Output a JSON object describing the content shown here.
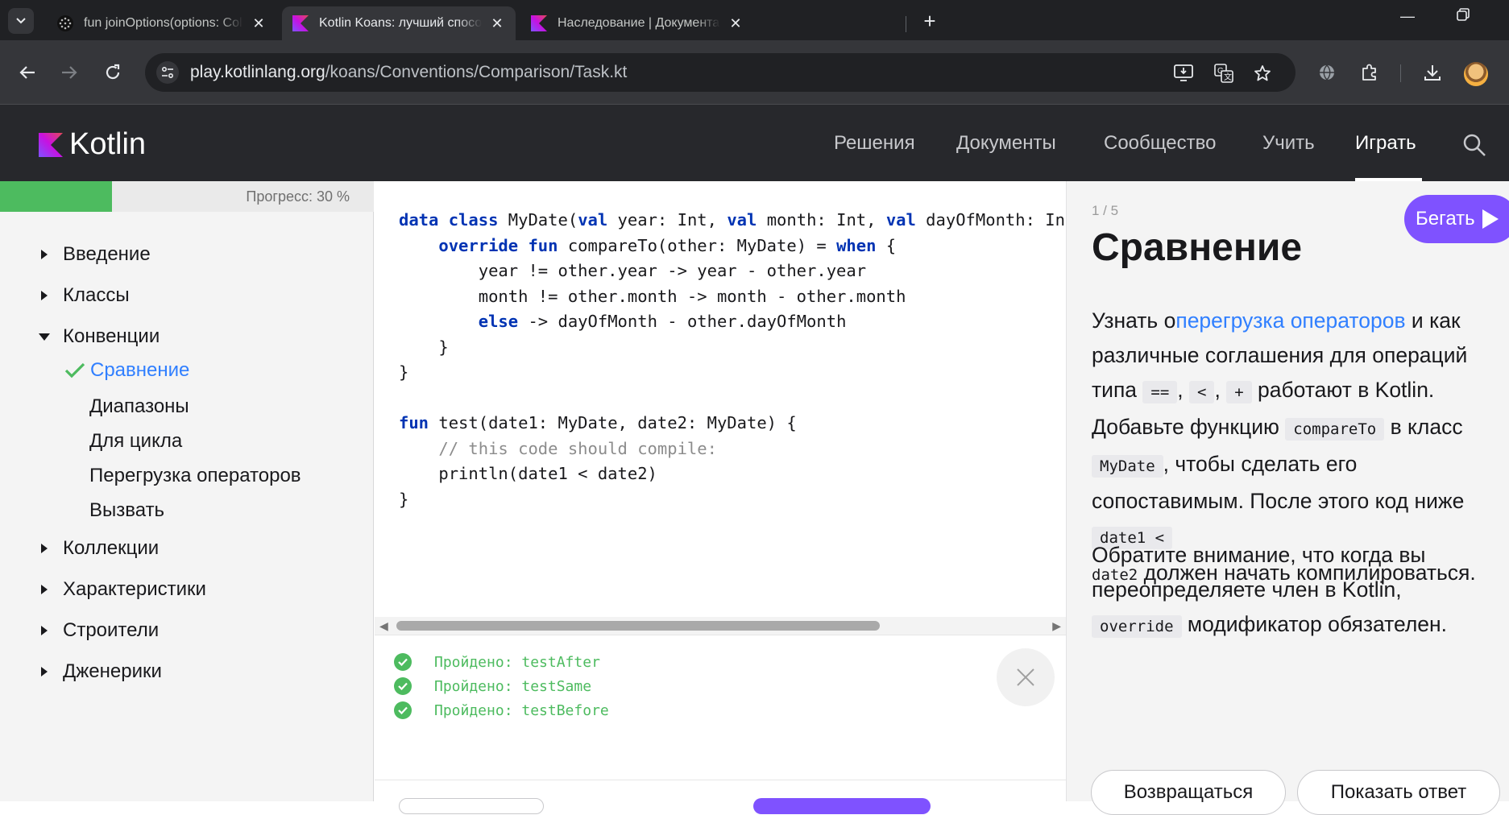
{
  "browser": {
    "tabs": [
      {
        "title": "fun joinOptions(options: Collect",
        "active": false
      },
      {
        "title": "Kotlin Koans: лучший способ и",
        "active": true
      },
      {
        "title": "Наследование | Документация",
        "active": false
      }
    ],
    "url_host": "play.kotlinlang.org",
    "url_path": "/koans/Conventions/Comparison/Task.kt",
    "icons": [
      "back-icon",
      "forward-icon",
      "reload-icon",
      "site-settings-icon",
      "install-app-icon",
      "translate-icon",
      "bookmark-star-icon",
      "globe-icon",
      "extensions-icon",
      "download-icon",
      "profile-avatar"
    ]
  },
  "site": {
    "logo_text": "Kotlin",
    "nav": [
      "Решения",
      "Документы",
      "Сообщество",
      "Учить",
      "Играть"
    ],
    "active_nav": "Играть"
  },
  "sidebar": {
    "progress_text": "Прогресс: 30 %",
    "progress_fraction": 0.3,
    "sections": [
      {
        "label": "Введение",
        "expanded": false
      },
      {
        "label": "Классы",
        "expanded": false
      },
      {
        "label": "Конвенции",
        "expanded": true
      },
      {
        "label": "Коллекции",
        "expanded": false
      },
      {
        "label": "Характеристики",
        "expanded": false
      },
      {
        "label": "Строители",
        "expanded": false
      },
      {
        "label": "Дженерики",
        "expanded": false
      }
    ],
    "subitems": [
      {
        "label": "Сравнение",
        "current": true,
        "done": true
      },
      {
        "label": "Диапазоны",
        "current": false
      },
      {
        "label": "Для цикла",
        "current": false
      },
      {
        "label": "Перегрузка операторов",
        "current": false
      },
      {
        "label": "Вызвать",
        "current": false
      }
    ]
  },
  "editor": {
    "lines": [
      "data class MyDate(val year: Int, val month: Int, val dayOfMonth: Int",
      "    override fun compareTo(other: MyDate) = when {",
      "        year != other.year -> year - other.year",
      "        month != other.month -> month - other.month",
      "        else -> dayOfMonth - other.dayOfMonth",
      "    }",
      "}",
      "",
      "fun test(date1: MyDate, date2: MyDate) {",
      "    // this code should compile:",
      "    println(date1 < date2)",
      "}"
    ]
  },
  "console": {
    "results": [
      "Пройдено: testAfter",
      "Пройдено: testSame",
      "Пройдено: testBefore"
    ]
  },
  "task": {
    "step": "1 / 5",
    "run_label": "Бегать",
    "title": "Сравнение",
    "p1_a": "Узнать о",
    "p1_link": "перегрузка операторов",
    "p1_b": " и как различные соглашения для операций типа ",
    "op_eq": "==",
    "op_lt": "<",
    "op_plus": "+",
    "p1_c": " работают в Kotlin. Добавьте функцию ",
    "code_compareTo": "compareTo",
    "p1_d": " в класс ",
    "code_mydate": "MyDate",
    "p1_e": ", чтобы сделать его сопоставимым. После этого код ниже ",
    "code_date1": "date1 <",
    "code_date2": "date2",
    "p1_f": " должен начать компилироваться.",
    "p2_a": "Обратите внимание, что когда вы переопределяете член в Kotlin, ",
    "code_override": "override",
    "p2_b": " модификатор обязателен.",
    "back_label": "Возвращаться",
    "answer_label": "Показать ответ"
  },
  "colors": {
    "accent": "#7f52ff",
    "link": "#307fff",
    "success": "#4dbb5f",
    "header_bg": "#27282c"
  }
}
